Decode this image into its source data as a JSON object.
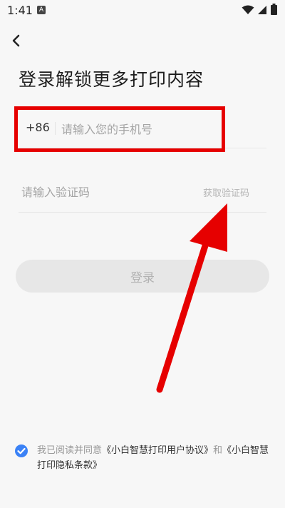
{
  "status_bar": {
    "time": "1:41",
    "app_icon_glyph": "A"
  },
  "page": {
    "title": "登录解锁更多打印内容"
  },
  "phone": {
    "prefix": "+86",
    "placeholder": "请输入您的手机号",
    "value": ""
  },
  "code": {
    "placeholder": "请输入验证码",
    "value": "",
    "get_code_label": "获取验证码"
  },
  "login": {
    "label": "登录"
  },
  "agreement": {
    "prefix": "我已阅读并同意",
    "user_agreement": "《小白智慧打印用户协议》",
    "conjunction": "和",
    "privacy_policy": "《小白智慧打印隐私条款》",
    "checked": true
  },
  "colors": {
    "annotation_red": "#e60000",
    "check_blue": "#3b82f6",
    "disabled_button": "#e7e7e7",
    "background": "#f7f7f7"
  },
  "icons": [
    "wifi-icon",
    "signal-icon",
    "battery-icon",
    "back-arrow-icon",
    "check-circle-icon"
  ]
}
